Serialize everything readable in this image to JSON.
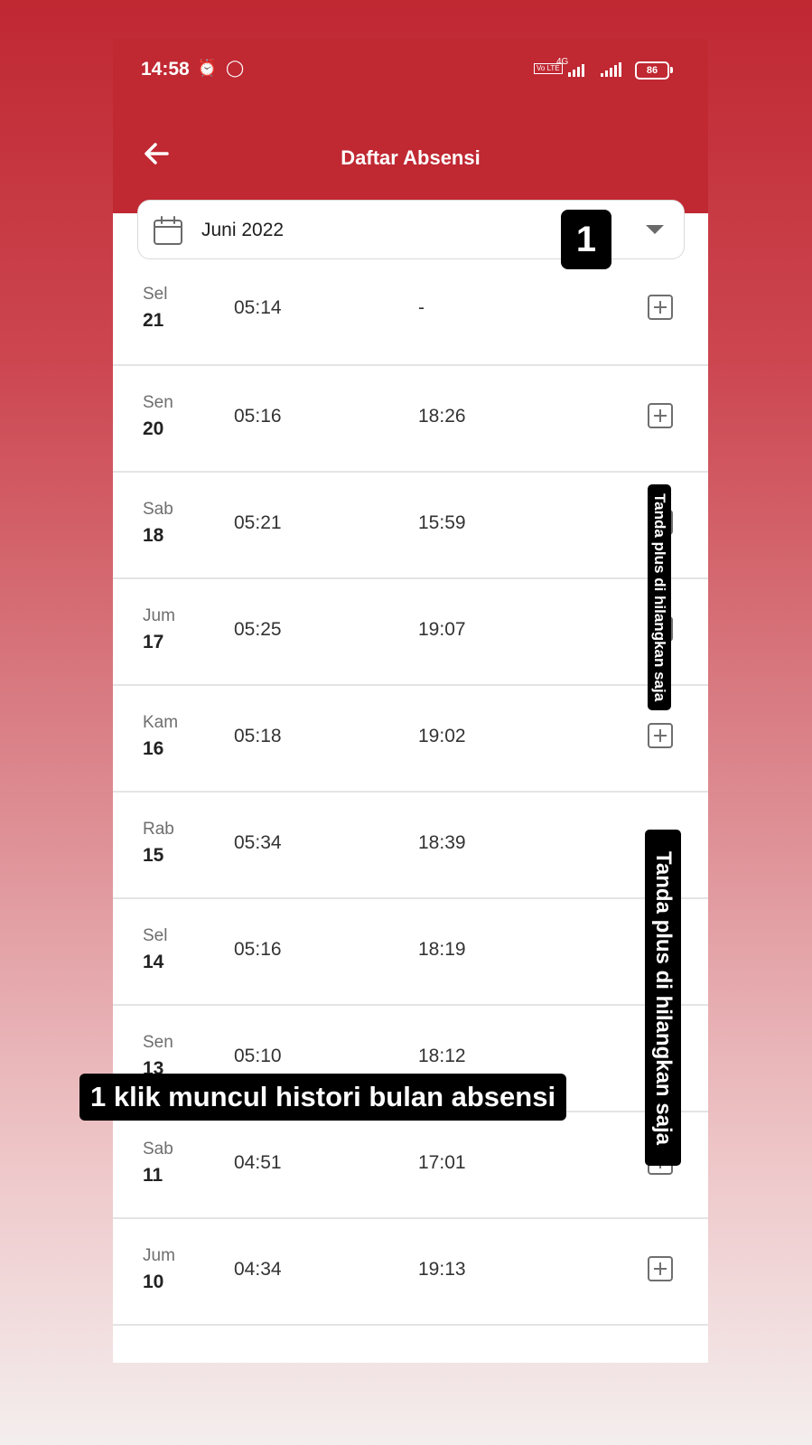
{
  "status_bar": {
    "time": "14:58",
    "network_type": "4G",
    "volte_label": "Vo LTE",
    "battery_level": "86"
  },
  "app_bar": {
    "title": "Daftar Absensi",
    "back_icon": "arrow-left-icon"
  },
  "month_picker": {
    "value": "Juni 2022",
    "icon": "calendar-icon"
  },
  "attendance": [
    {
      "day": "Sel",
      "date": "21",
      "check_in": "05:14",
      "check_out": "-",
      "has_plus": true
    },
    {
      "day": "Sen",
      "date": "20",
      "check_in": "05:16",
      "check_out": "18:26",
      "has_plus": true
    },
    {
      "day": "Sab",
      "date": "18",
      "check_in": "05:21",
      "check_out": "15:59",
      "has_plus": true
    },
    {
      "day": "Jum",
      "date": "17",
      "check_in": "05:25",
      "check_out": "19:07",
      "has_plus": true
    },
    {
      "day": "Kam",
      "date": "16",
      "check_in": "05:18",
      "check_out": "19:02",
      "has_plus": true
    },
    {
      "day": "Rab",
      "date": "15",
      "check_in": "05:34",
      "check_out": "18:39",
      "has_plus": false
    },
    {
      "day": "Sel",
      "date": "14",
      "check_in": "05:16",
      "check_out": "18:19",
      "has_plus": false
    },
    {
      "day": "Sen",
      "date": "13",
      "check_in": "05:10",
      "check_out": "18:12",
      "has_plus": false
    },
    {
      "day": "Sab",
      "date": "11",
      "check_in": "04:51",
      "check_out": "17:01",
      "has_plus": true
    },
    {
      "day": "Jum",
      "date": "10",
      "check_in": "04:34",
      "check_out": "19:13",
      "has_plus": true
    }
  ],
  "annotations": {
    "marker_number": "1",
    "caption_month": "1 klik muncul histori bulan absensi",
    "caption_plus_small": "Tanda plus di hilangkan saja",
    "caption_plus_large": "Tanda plus di hilangkan saja"
  },
  "colors": {
    "primary": "#c02832",
    "divider": "#e4e4e4",
    "icon_gray": "#6f6f6f"
  }
}
